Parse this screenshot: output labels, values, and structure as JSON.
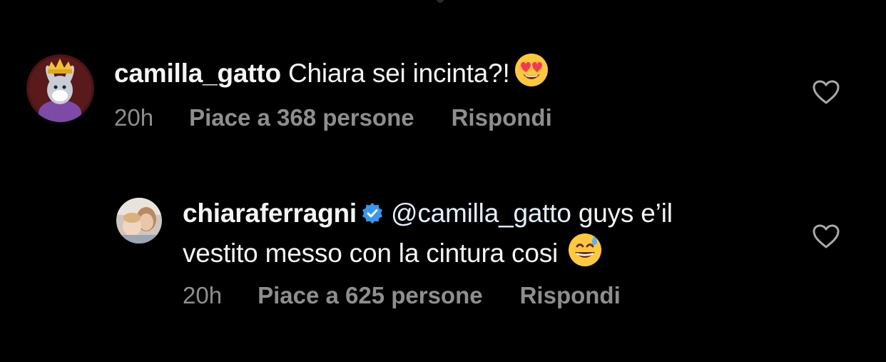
{
  "comments": [
    {
      "username": "camilla_gatto",
      "text": "Chiara sei incinta?!",
      "emoji": "smiling-face-with-heart-eyes",
      "time": "20h",
      "likes": "Piace a 368 persone",
      "reply": "Rispondi",
      "verified": false,
      "avatar_icon": "crowned-bunny-avatar"
    },
    {
      "username": "chiaraferragni",
      "mention": "@camilla_gatto",
      "text_line1": "guys e’il",
      "text_line2": "vestito messo con la cintura cosi",
      "emoji": "grinning-face-with-sweat",
      "time": "20h",
      "likes": "Piace a 625 persone",
      "reply": "Rispondi",
      "verified": true,
      "avatar_icon": "user-photo-avatar"
    }
  ],
  "colors": {
    "background": "#000000",
    "text": "#f5f5f5",
    "meta": "#8e8e8e",
    "mention": "#e0f1ff",
    "verified": "#3897f0"
  }
}
